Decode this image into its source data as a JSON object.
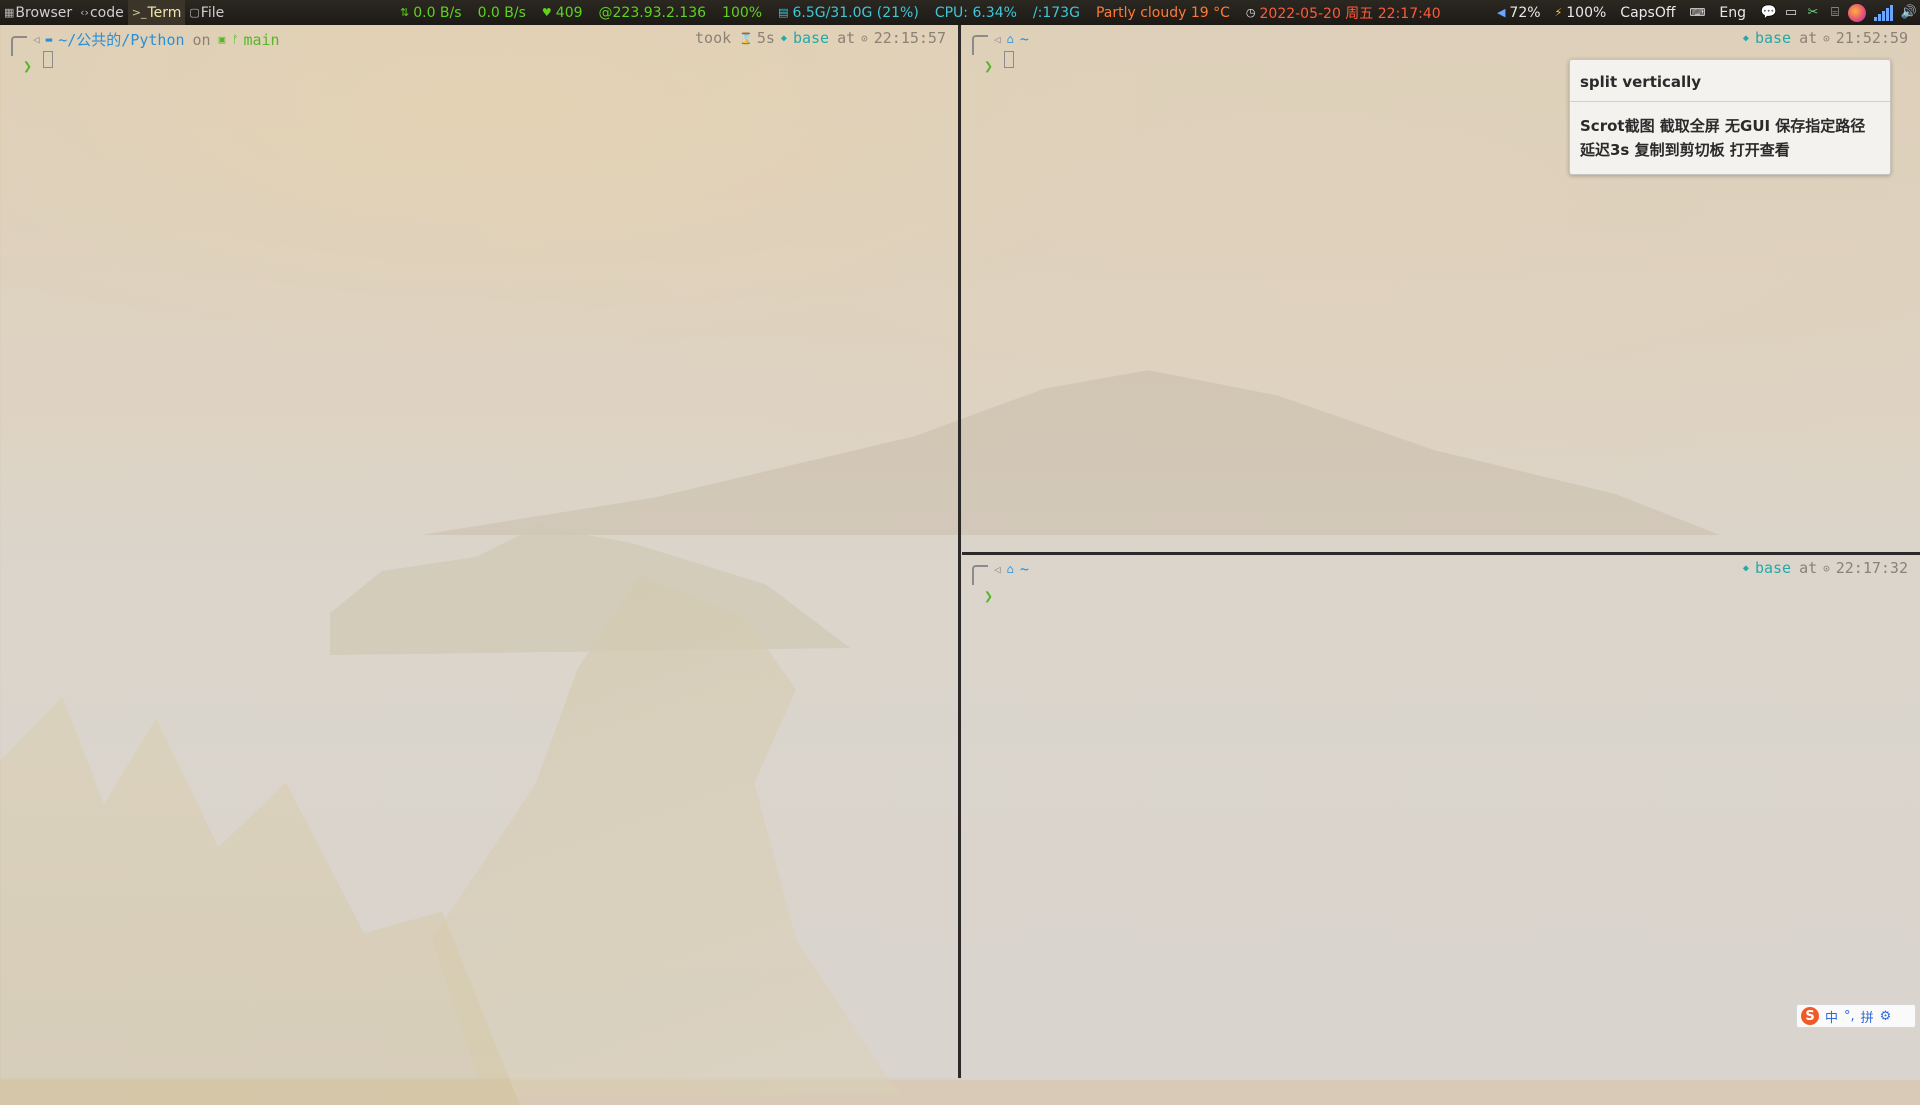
{
  "topbar": {
    "workspaces": [
      {
        "icon": "browser-icon",
        "label": "Browser"
      },
      {
        "icon": "code-icon",
        "label": "code"
      },
      {
        "icon": "terminal-icon",
        "label": "Term"
      },
      {
        "icon": "file-icon",
        "label": "File"
      }
    ],
    "net_up": "0.0 B/s",
    "net_down": "0.0 B/s",
    "ping": "409",
    "ip": "@223.93.2.136",
    "volume_bar": "100%",
    "memory": "6.5G/31.0G (21%)",
    "cpu": "CPU: 6.34%",
    "disk": "/:173G",
    "weather": "Partly cloudy 19 °C",
    "datetime": "2022-05-20 周五 22:17:40",
    "speaker": "72%",
    "battery": "100%",
    "capslock": "CapsOff",
    "keyboard_layout": "Eng"
  },
  "terminals": {
    "left": {
      "path": "~/公共的/Python",
      "on_word": "on",
      "branch": "main",
      "took_word": "took",
      "duration": "5s",
      "env": "base",
      "at_word": "at",
      "time": "22:15:57"
    },
    "top_right": {
      "path": "~",
      "env": "base",
      "at_word": "at",
      "time": "21:52:59"
    },
    "bottom_right": {
      "path": "~",
      "env": "base",
      "at_word": "at",
      "time": "22:17:32"
    }
  },
  "notification": {
    "title": "split vertically",
    "body_line1": "Scrot截图 截取全屏 无GUI 保存指定路径",
    "body_line2": "延迟3s 复制到剪切板 打开查看"
  },
  "ime": {
    "logo": "S",
    "mode": "中",
    "punct": "°,",
    "layout": "拼"
  },
  "colors": {
    "accent_green": "#5fd21f",
    "accent_cyan": "#3ec7d6",
    "weather_orange": "#ff7a33",
    "path_blue": "#2b8fd6",
    "env_teal": "#23a9a9"
  }
}
